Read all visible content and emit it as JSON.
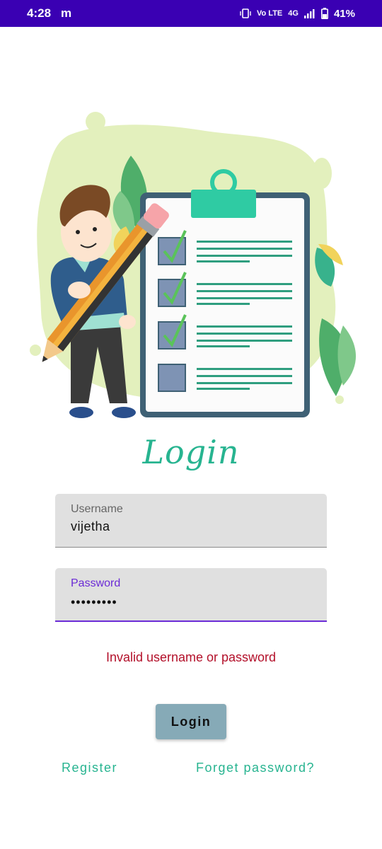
{
  "status_bar": {
    "time": "4:28",
    "notification_icon": "m",
    "volte_label": "Vo LTE",
    "network_label": "4G",
    "battery_percent": "41%"
  },
  "title": "Login",
  "username": {
    "label": "Username",
    "value": "vijetha"
  },
  "password": {
    "label": "Password",
    "value": "•••••••••"
  },
  "error_message": "Invalid username or password",
  "login_button": "Login",
  "links": {
    "register": "Register",
    "forget_password": "Forget password?"
  },
  "colors": {
    "status_bar": "#3a00b3",
    "accent_green": "#27b490",
    "focus_purple": "#6b2bd6",
    "error_red": "#b3102a",
    "button": "#86aab7"
  }
}
